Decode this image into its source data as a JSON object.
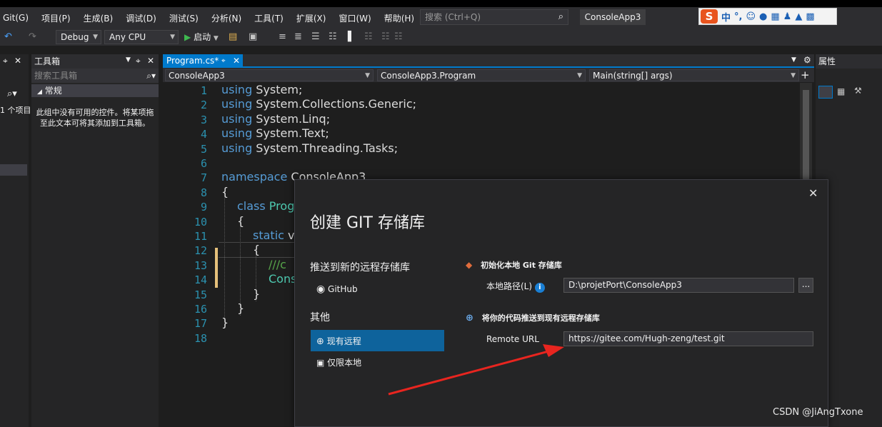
{
  "menu": {
    "items": [
      "Git(G)",
      "项目(P)",
      "生成(B)",
      "调试(D)",
      "测试(S)",
      "分析(N)",
      "工具(T)",
      "扩展(X)",
      "窗口(W)",
      "帮助(H)"
    ],
    "search_placeholder": "搜索 (Ctrl+Q)",
    "app_title": "ConsoleApp3"
  },
  "ime": {
    "logo": "S",
    "mode": "中"
  },
  "toolbar": {
    "config": "Debug",
    "platform": "Any CPU",
    "start_label": "启动"
  },
  "toolbox": {
    "title": "工具箱",
    "search_placeholder": "搜索工具箱",
    "category": "常规",
    "empty_message": "此组中没有可用的控件。将某项拖至此文本可将其添加到工具箱。"
  },
  "left_strip": {
    "items_label": "1 个项目"
  },
  "editor": {
    "tab_label": "Program.cs*",
    "nav_project": "ConsoleApp3",
    "nav_class": "ConsoleApp3.Program",
    "nav_member": "Main(string[] args)",
    "lines": [
      {
        "n": "1",
        "kw": "using",
        "rest": " System;"
      },
      {
        "n": "2",
        "kw": "using",
        "rest": " System.Collections.Generic;"
      },
      {
        "n": "3",
        "kw": "using",
        "rest": " System.Linq;"
      },
      {
        "n": "4",
        "kw": "using",
        "rest": " System.Text;"
      },
      {
        "n": "5",
        "kw": "using",
        "rest": " System.Threading.Tasks;"
      },
      {
        "n": "6",
        "kw": "",
        "rest": ""
      },
      {
        "n": "7",
        "kw": "namespace",
        "rest": " ConsoleApp3"
      },
      {
        "n": "8",
        "kw": "",
        "rest": "{"
      },
      {
        "n": "9",
        "kw": "class",
        "rest": " Prog"
      },
      {
        "n": "10",
        "kw": "",
        "rest": "{"
      },
      {
        "n": "11",
        "kw": "static",
        "rest": " v"
      },
      {
        "n": "12",
        "kw": "",
        "rest": "{"
      },
      {
        "n": "13",
        "kw": "",
        "rest": "///c"
      },
      {
        "n": "14",
        "kw": "",
        "rest": "Cons"
      },
      {
        "n": "15",
        "kw": "",
        "rest": "}"
      },
      {
        "n": "16",
        "kw": "",
        "rest": "}"
      },
      {
        "n": "17",
        "kw": "",
        "rest": "}"
      },
      {
        "n": "18",
        "kw": "",
        "rest": ""
      }
    ]
  },
  "properties": {
    "title": "属性"
  },
  "dialog": {
    "title": "创建 GIT 存储库",
    "push_new_section": "推送到新的远程存储库",
    "github_label": "GitHub",
    "other_section": "其他",
    "existing_remote_label": "现有远程",
    "local_only_label": "仅限本地",
    "init_local_header": "初始化本地 Git 存储库",
    "local_path_label": "本地路径(L)",
    "local_path_value": "D:\\projetPort\\ConsoleApp3",
    "browse_label": "...",
    "push_existing_header": "将你的代码推送到现有远程存储库",
    "remote_url_label": "Remote URL",
    "remote_url_value": "https://gitee.com/Hugh-zeng/test.git"
  },
  "watermark": "CSDN @JiAngTxone",
  "colors": {
    "accent": "#007acc",
    "selection": "#0e639c",
    "keyword": "#569cd6",
    "arrow": "#e8251f"
  }
}
